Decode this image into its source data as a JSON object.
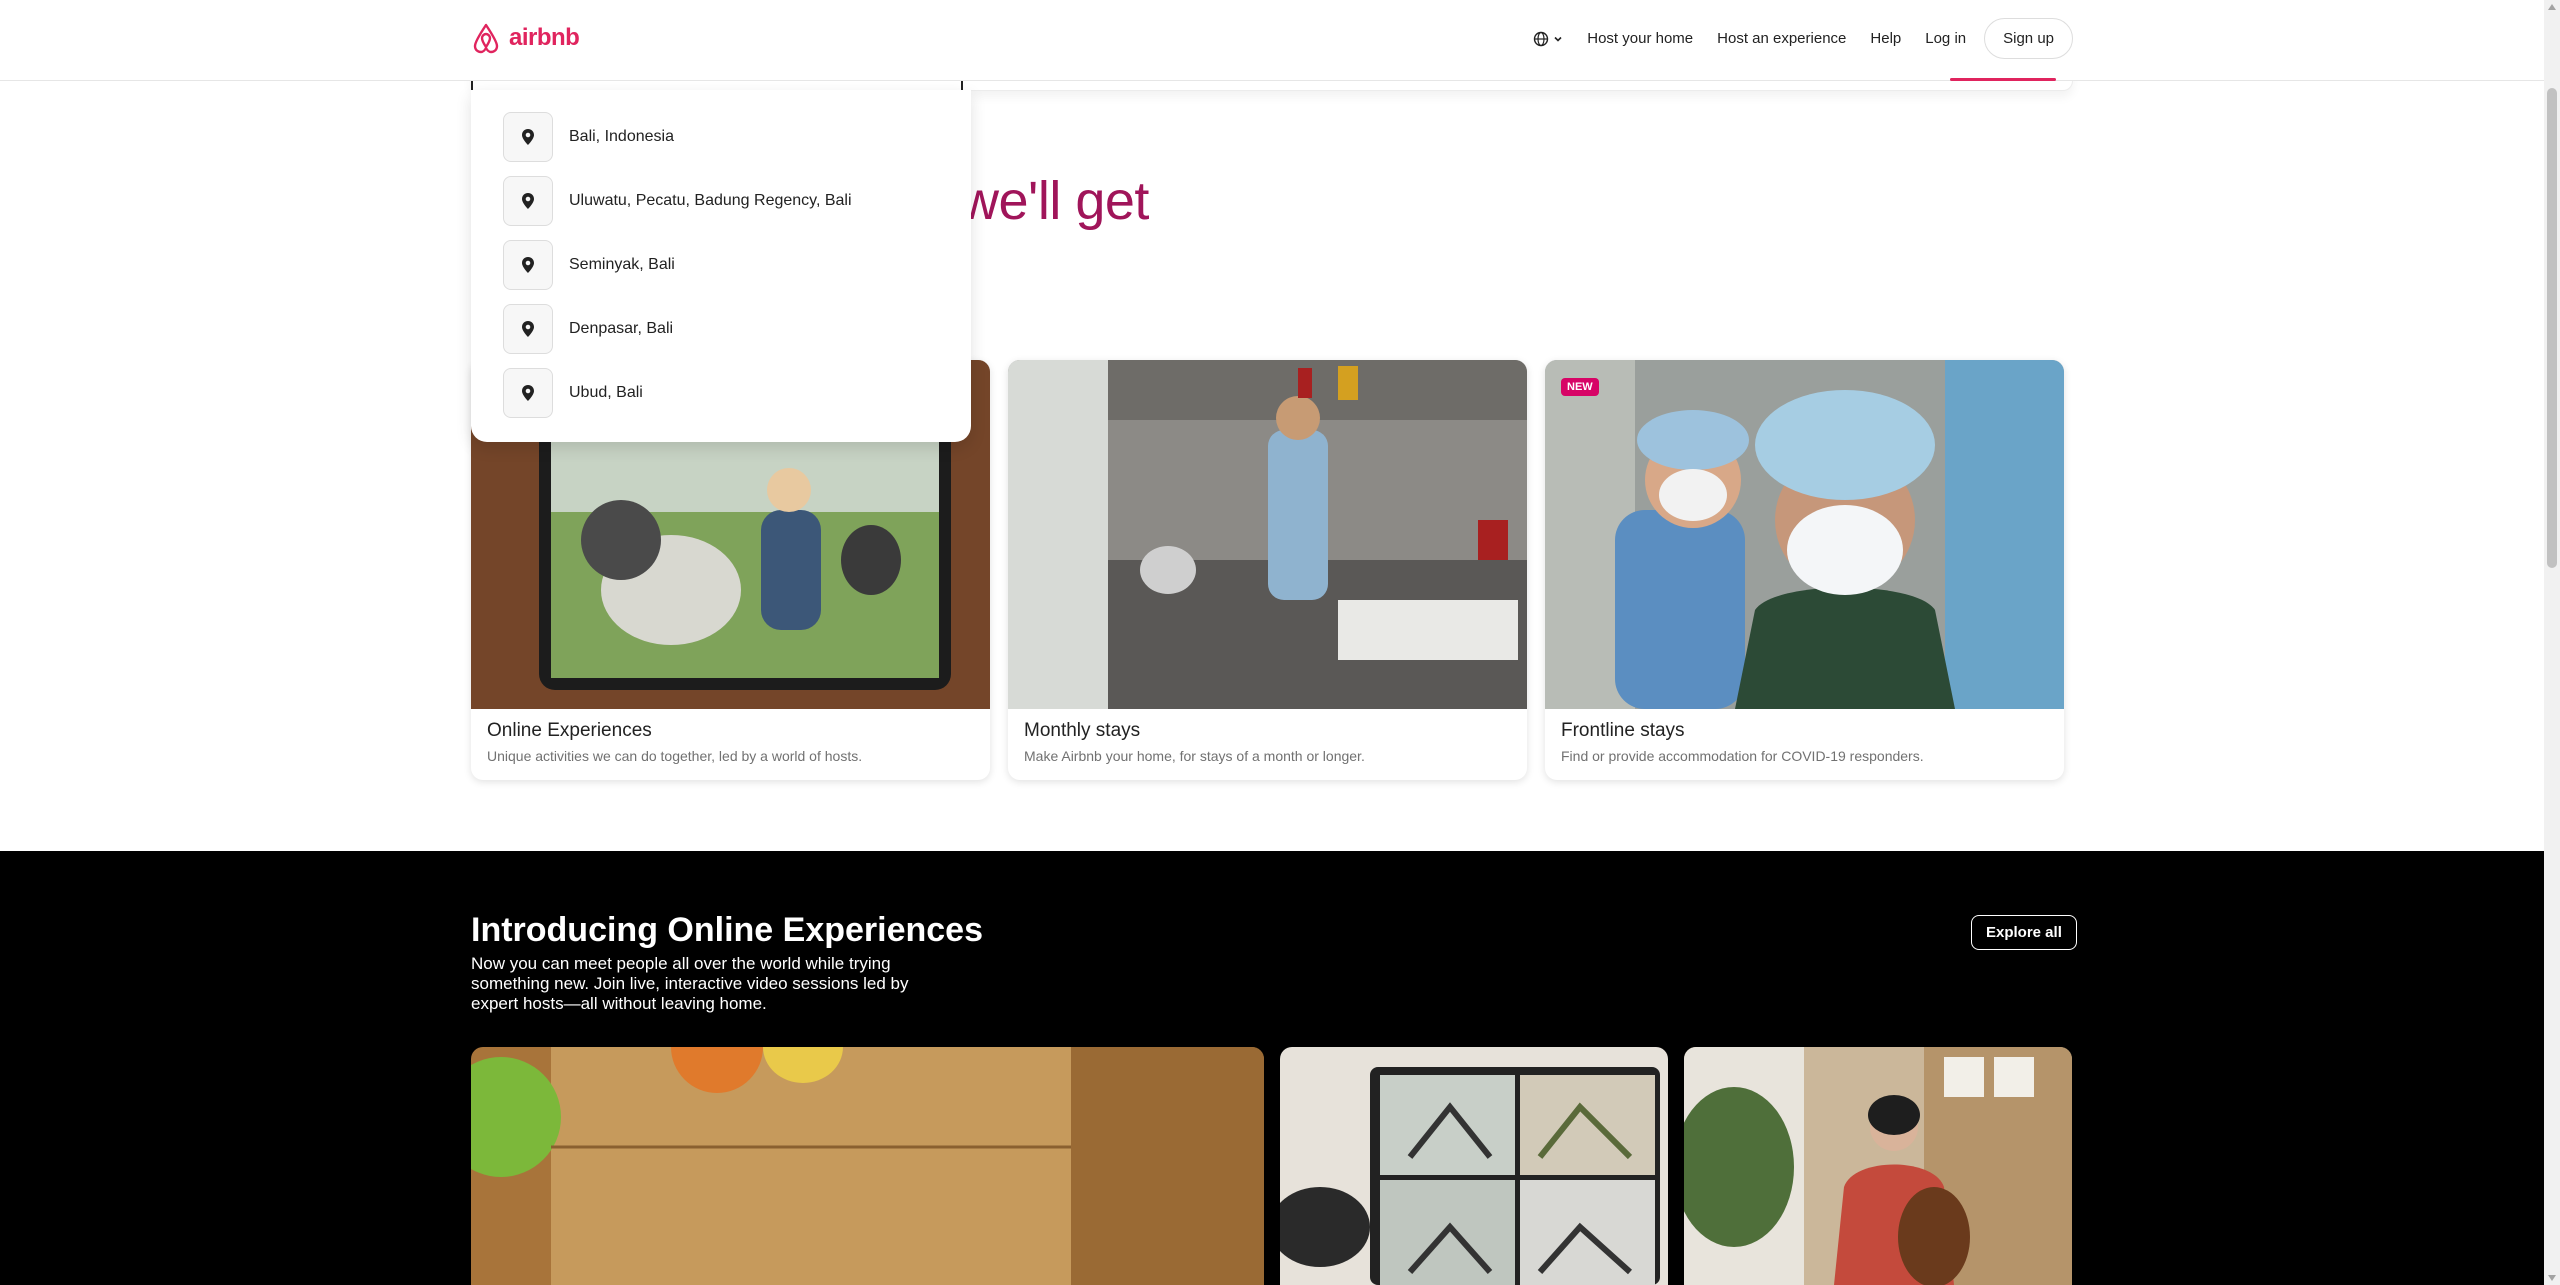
{
  "header": {
    "logo_text": "airbnb",
    "nav": {
      "host_home": "Host your home",
      "host_experience": "Host an experience",
      "help": "Help",
      "login": "Log in",
      "signup": "Sign up"
    }
  },
  "hero": {
    "partial_text": "we'll get"
  },
  "suggestions": [
    {
      "label": "Bali, Indonesia",
      "icon": "location-pin-icon"
    },
    {
      "label": "Uluwatu, Pecatu, Badung Regency, Bali",
      "icon": "location-pin-icon"
    },
    {
      "label": "Seminyak, Bali",
      "icon": "location-pin-icon"
    },
    {
      "label": "Denpasar, Bali",
      "icon": "location-pin-icon"
    },
    {
      "label": "Ubud, Bali",
      "icon": "location-pin-icon"
    }
  ],
  "cards": [
    {
      "title": "Online Experiences",
      "subtitle": "Unique activities we can do together, led by a world of hosts."
    },
    {
      "title": "Monthly stays",
      "subtitle": "Make Airbnb your home, for stays of a month or longer."
    },
    {
      "title": "Frontline stays",
      "subtitle": "Find or provide accommodation for COVID-19 responders.",
      "badge": "NEW"
    }
  ],
  "online_experiences": {
    "title": "Introducing Online Experiences",
    "description": "Now you can meet people all over the world while trying something new. Join live, interactive video sessions led by expert hosts—all without leaving home.",
    "explore_label": "Explore all"
  },
  "colors": {
    "brand": "#e0245e",
    "hero": "#a0155a",
    "badge": "#d70466"
  }
}
